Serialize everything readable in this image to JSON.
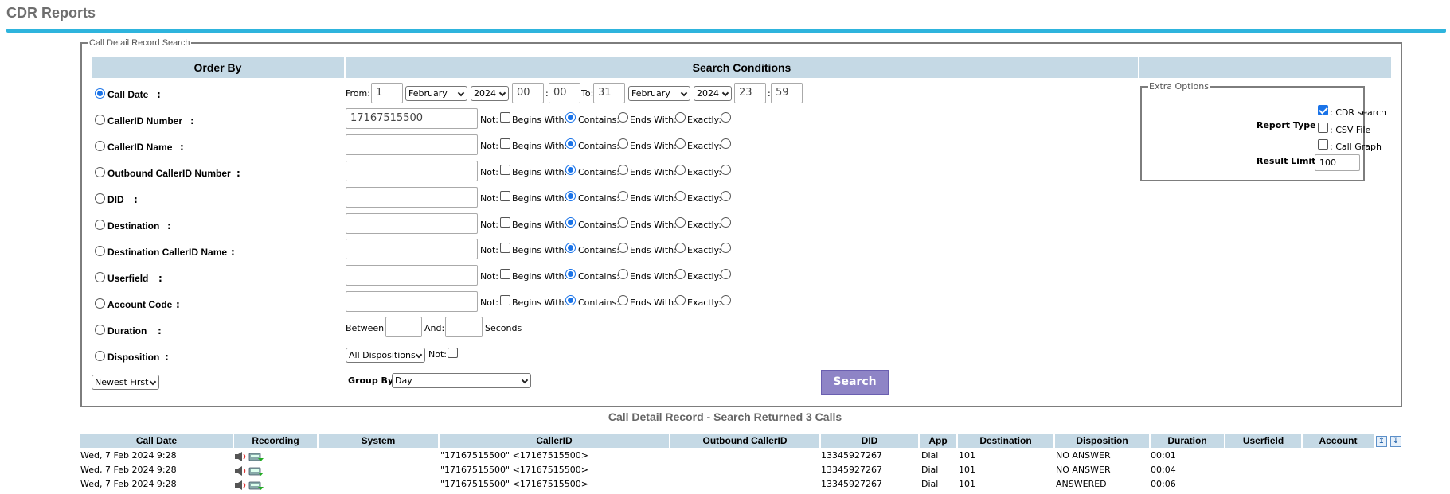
{
  "page": {
    "title": "CDR Reports"
  },
  "search": {
    "legend": "Call Detail Record Search",
    "headers": {
      "order_by": "Order By",
      "conditions": "Search Conditions",
      "extra": ""
    },
    "order_by": [
      {
        "label": "Call Date",
        "selected": true
      },
      {
        "label": "CallerID Number",
        "selected": false
      },
      {
        "label": "CallerID Name",
        "selected": false
      },
      {
        "label": "Outbound CallerID Number",
        "selected": false
      },
      {
        "label": "DID",
        "selected": false
      },
      {
        "label": "Destination",
        "selected": false
      },
      {
        "label": "Destination CallerID Name",
        "selected": false
      },
      {
        "label": "Userfield",
        "selected": false
      },
      {
        "label": "Account Code",
        "selected": false
      },
      {
        "label": "Duration",
        "selected": false
      },
      {
        "label": "Disposition",
        "selected": false
      }
    ],
    "order_colon": ":",
    "sort_order": "Newest First",
    "date": {
      "from_label": "From:",
      "to_label": "To:",
      "colon": ":",
      "from_day": "1",
      "from_month": "February",
      "from_year": "2024",
      "from_hour": "00",
      "from_min": "00",
      "to_day": "31",
      "to_month": "February",
      "to_year": "2024",
      "to_hour": "23",
      "to_min": "59"
    },
    "match": {
      "not": "Not:",
      "begins": "Begins With:",
      "contains": "Contains:",
      "ends": "Ends With:",
      "exactly": "Exactly:"
    },
    "fields": [
      "17167515500",
      "",
      "",
      "",
      "",
      "",
      "",
      ""
    ],
    "duration": {
      "between": "Between:",
      "and": "And:",
      "seconds": "Seconds",
      "min": "",
      "max": ""
    },
    "disposition": {
      "value": "All Dispositions",
      "not": "Not:"
    },
    "group_by": {
      "label": "Group By:",
      "value": "Day"
    },
    "search_button": "Search"
  },
  "extra": {
    "legend": "Extra Options",
    "report_type_label": "Report Type :",
    "options": [
      {
        "label": ": CDR search",
        "checked": true
      },
      {
        "label": ": CSV File",
        "checked": false
      },
      {
        "label": ": Call Graph",
        "checked": false
      }
    ],
    "result_limit_label": "Result Limit :",
    "result_limit": "100"
  },
  "results": {
    "title": "Call Detail Record - Search Returned 3 Calls",
    "columns": [
      "Call Date",
      "Recording",
      "System",
      "CallerID",
      "Outbound CallerID",
      "DID",
      "App",
      "Destination",
      "Disposition",
      "Duration",
      "Userfield",
      "Account"
    ],
    "rows": [
      {
        "date": "Wed, 7 Feb 2024 9:28",
        "system": "",
        "callerid": "\"17167515500\" <17167515500>",
        "outbound": "",
        "did": "13345927267",
        "app": "Dial",
        "destination": "101",
        "disposition": "NO ANSWER",
        "duration": "00:01",
        "userfield": "",
        "account": ""
      },
      {
        "date": "Wed, 7 Feb 2024 9:28",
        "system": "",
        "callerid": "\"17167515500\" <17167515500>",
        "outbound": "",
        "did": "13345927267",
        "app": "Dial",
        "destination": "101",
        "disposition": "NO ANSWER",
        "duration": "00:04",
        "userfield": "",
        "account": ""
      },
      {
        "date": "Wed, 7 Feb 2024 9:28",
        "system": "",
        "callerid": "\"17167515500\" <17167515500>",
        "outbound": "",
        "did": "13345927267",
        "app": "Dial",
        "destination": "101",
        "disposition": "ANSWERED",
        "duration": "00:06",
        "userfield": "",
        "account": ""
      }
    ]
  }
}
